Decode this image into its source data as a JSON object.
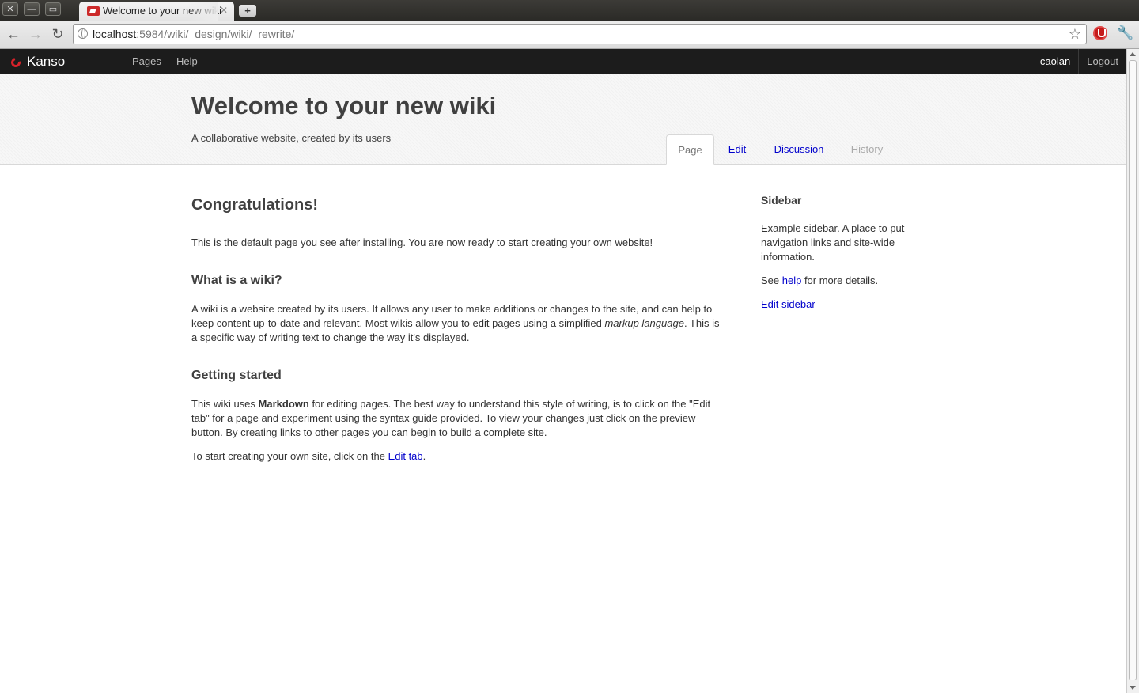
{
  "browser": {
    "tab_title": "Welcome to your new wiki",
    "url_host": "localhost",
    "url_path": ":5984/wiki/_design/wiki/_rewrite/",
    "window_buttons": [
      "✕",
      "—",
      "▭"
    ],
    "new_tab_label": "+"
  },
  "topbar": {
    "brand": "Kanso",
    "nav": [
      "Pages",
      "Help"
    ],
    "username": "caolan",
    "logout": "Logout"
  },
  "header": {
    "title": "Welcome to your new wiki",
    "subtitle": "A collaborative website, created by its users",
    "tabs": {
      "page": "Page",
      "edit": "Edit",
      "discussion": "Discussion",
      "history": "History"
    }
  },
  "content": {
    "h1": "Congratulations!",
    "p1": "This is the default page you see after installing. You are now ready to start creating your own website!",
    "h2_wiki": "What is a wiki?",
    "p_wiki_a": "A wiki is a website created by its users. It allows any user to make additions or changes to the site, and can help to keep content up-to-date and relevant. Most wikis allow you to edit pages using a simplified ",
    "p_wiki_em": "markup language",
    "p_wiki_b": ". This is a specific way of writing text to change the way it's displayed.",
    "h2_start": "Getting started",
    "p_start_a": "This wiki uses ",
    "p_start_strong": "Markdown",
    "p_start_b": " for editing pages. The best way to understand this style of writing, is to click on the \"Edit tab\" for a page and experiment using the syntax guide provided. To view your changes just click on the preview button. By creating links to other pages you can begin to build a complete site.",
    "p_last_a": "To start creating your own site, click on the ",
    "p_last_link": "Edit tab",
    "p_last_b": "."
  },
  "sidebar": {
    "title": "Sidebar",
    "text": "Example sidebar. A place to put navigation links and site-wide information.",
    "see_a": "See ",
    "see_link": "help",
    "see_b": " for more details.",
    "edit_link": "Edit sidebar"
  }
}
